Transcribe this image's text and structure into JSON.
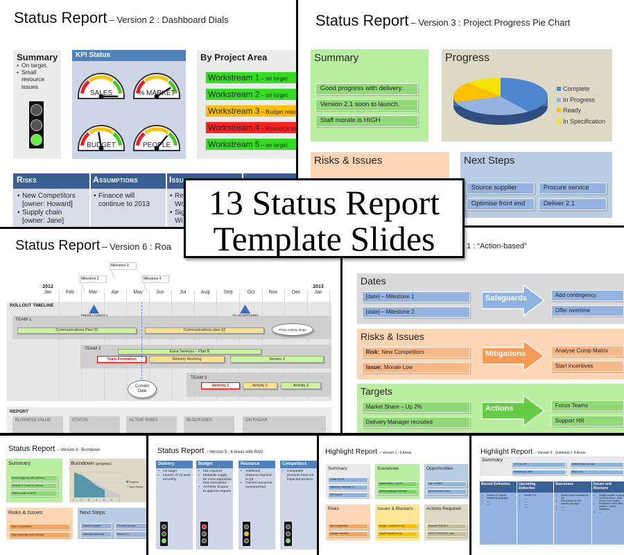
{
  "promo_title": {
    "line1": "13 Status Report",
    "line2": "Template Slides"
  },
  "s1": {
    "title": "Status Report",
    "subtitle": "– Version 2 : Dashboard Dials",
    "summary": {
      "heading": "Summary",
      "bullets": [
        "On target.",
        "Small resource issues"
      ],
      "rag": "green"
    },
    "kpi": {
      "heading": "KPI Status",
      "gauges": [
        {
          "label": "SALES",
          "value": 1.0
        },
        {
          "label": "% MARKET",
          "value": 0.82
        },
        {
          "label": "BUDGET",
          "value": 0.45
        },
        {
          "label": "PEOPLE",
          "value": 0.72
        }
      ]
    },
    "project_area": {
      "heading": "By Project Area",
      "rows": [
        {
          "name": "Workstream 1",
          "status": "– on target",
          "color": "#33dd22"
        },
        {
          "name": "Workstream 2",
          "status": "– on target",
          "color": "#33dd22"
        },
        {
          "name": "Workstream 3",
          "status": "– Budget require",
          "color": "#ffc000"
        },
        {
          "name": "Workstream 4",
          "status": "– Resource issu",
          "color": "#ff2020"
        },
        {
          "name": "Workstream 5",
          "status": "– on target",
          "color": "#33dd22"
        }
      ]
    },
    "table": [
      {
        "heading": "Risks",
        "bullets": [
          "New Competitors [owner: Howard]",
          "Supply chain [owner: Jane]"
        ]
      },
      {
        "heading": "Assumptions",
        "bullets": [
          "Finance will continue to 2013"
        ]
      },
      {
        "heading": "Issues",
        "bullets": [
          "Re\nWo",
          "Sig\nWi"
        ]
      }
    ]
  },
  "s2": {
    "title": "Status Report",
    "subtitle": "– Version 3 : Project Progress Pie Chart",
    "summary": {
      "heading": "Summary",
      "items": [
        "Good progress with delivery.",
        "Version 2.1 soon to launch.",
        "Staff morale is HIGH"
      ]
    },
    "progress": {
      "heading": "Progress"
    },
    "risks": {
      "heading": "Risks & Issues"
    },
    "next_steps": {
      "heading": "Next Steps",
      "items": [
        "Source supplier",
        "Procure service",
        "Optimise front end",
        "Deliver 2.1"
      ]
    },
    "chart_data": {
      "type": "pie",
      "categories": [
        "Complete",
        "In Progress",
        "Ready",
        "In Specification"
      ],
      "values": [
        40,
        30,
        18,
        12
      ],
      "colors": [
        "#4f86d0",
        "#95b3e0",
        "#ffc000",
        "#f5e400"
      ],
      "legend": "right"
    }
  },
  "s3": {
    "title": "Status Report",
    "subtitle": "– Version 6 : Roa",
    "years": [
      "2012",
      "2013"
    ],
    "months": [
      "Jan",
      "Feb",
      "Mar",
      "Apr",
      "May",
      "Jun",
      "Jul",
      "Aug",
      "Sep",
      "Oct",
      "Nov",
      "Dec",
      "Jan"
    ],
    "milestones": [
      "Milestone 2",
      "Milestone 3",
      "Milestone 4"
    ],
    "timeline_label": "ROLLOUT TIMELINE",
    "events": [
      "PRESS LAUNCH 1",
      "TV ADVERTISING"
    ],
    "teams": [
      "TEAM 1",
      "TEAM 2",
      "TEAM 3"
    ],
    "bars": {
      "comms1": "Communications Plan 01",
      "comms2": "Communications plan 02",
      "press_stops": "Press Activity Stops",
      "extra": "Extra Services – Plan B",
      "formation": "Team Formation",
      "norming": "Delivery Norming",
      "version2": "Version 2",
      "act1": "Activity 1",
      "act2": "Activity 2",
      "act3": "Activity 3"
    },
    "current_date": "Current Date",
    "report_label": "REPORT",
    "report_columns": [
      "BUSINESS VALUE",
      "STATUS",
      "ACTIVE RISKS",
      "BLOCKAGES",
      "ON RADAR"
    ]
  },
  "s4": {
    "subtitle": "1 : “Action-based”",
    "rows": [
      {
        "heading": "Dates",
        "left": [
          "[date] – Milestone 1",
          "[date] – Milestone 2"
        ],
        "arrow": "Safeguards",
        "right": [
          "Add contingency",
          "Offer overtime"
        ],
        "bg": "#d9d9d9",
        "item": "#95b3e0",
        "arrow_color": "#8db3e2"
      },
      {
        "heading": "Risks & Issues",
        "left_bold": [
          "Risk:",
          "Issue:"
        ],
        "left": [
          "New Competitors",
          "Morale Low"
        ],
        "arrow": "Mitigations",
        "right": [
          "Analyse Comp Matrix",
          "Start incentives"
        ],
        "bg": "#fcd5b4",
        "item": "#f8b888",
        "arrow_color": "#f79a55"
      },
      {
        "heading": "Targets",
        "left": [
          "Market Share – Up 2%",
          "Delivery Manager recruited"
        ],
        "arrow": "Actions",
        "right": [
          "Focus Teams",
          "Support HR"
        ],
        "bg": "#b8f0a0",
        "item": "#92d97a",
        "arrow_color": "#66cc44"
      }
    ]
  },
  "b1": {
    "title": "Status Report",
    "subtitle": "– Version 4 : Burndown",
    "summary": {
      "heading": "Summary",
      "items": [
        "Good progress with delivery.",
        "Version 2.1 soon to launch.",
        "Staff morale is HIGH"
      ]
    },
    "burndown": {
      "heading": "Burndown",
      "sub": "(progress)"
    },
    "chart_data": {
      "type": "area",
      "x": [
        1,
        2,
        3,
        4,
        5,
        6,
        7
      ],
      "series": [
        {
          "name": "Progress",
          "values": [
            10,
            9,
            7,
            4.5,
            3,
            null,
            null
          ]
        },
        {
          "name": "Ideal Velocity",
          "values": [
            10,
            8.5,
            7,
            5.5,
            4,
            2.5,
            1
          ]
        }
      ],
      "colors": [
        "#4a8fa8",
        "#c8c8c8"
      ]
    },
    "risks": {
      "heading": "Risks & Issues",
      "items": [
        "New Competitors",
        "Raw materials cost increase"
      ]
    },
    "next_steps": {
      "heading": "Next Steps",
      "items": [
        "Source supplier",
        "Procure service",
        "Optimise front end",
        "Deliver 2.1"
      ]
    }
  },
  "b2": {
    "title": "Status Report",
    "subtitle": "– Version 5 : 4 Areas with RAG",
    "columns": [
      {
        "heading": "Delivery",
        "bullets": [
          "On target",
          "Launch of V3 went smoothly"
        ],
        "rag": "green"
      },
      {
        "heading": "Budget",
        "bullets": [
          "£££ required",
          "Materials supply far more expensive than forecasted",
          "ACTION: finance to approve request"
        ],
        "rag": "red"
      },
      {
        "heading": "Resource",
        "bullets": [
          "Additional resource required in Q4",
          "Current resources overstretched"
        ],
        "rag": "amber"
      },
      {
        "heading": "Competitors",
        "bullets": [
          "Competitor products have not impacted product"
        ],
        "rag": "green"
      }
    ]
  },
  "b3": {
    "title": "Highlight Report",
    "subtitle": "– Version 1 : 6 Areas",
    "areas": [
      {
        "heading": "Summary",
        "items": [
          "TEAM GOOD",
          "Marketing Campaign 1.2",
          "RIM support"
        ],
        "bg": "#e8e8e8",
        "item": "#8db3e2"
      },
      {
        "heading": "Successes",
        "items": [
          "Market Share – Up 2%",
          "Delivery Manager recruited"
        ],
        "bg": "#b8f0a0",
        "item": "#7bd66a"
      },
      {
        "heading": "Opportunities",
        "items": [
          "Gap in EMEA",
          "Innovate feature idea"
        ],
        "bg": "#b8cce4",
        "item": "#95b3e0"
      },
      {
        "heading": "Risks",
        "items": [
          "New Competitors",
          "Manager recruited"
        ],
        "bg": "#fcd5b4",
        "item": "#f4a460"
      },
      {
        "heading": "Issues & Blockers",
        "items": [
          "Budget – required for Q4",
          "Signoff required on Q3"
        ],
        "bg": "#ffe699",
        "item": "#ffc000"
      },
      {
        "heading": "Actions Required",
        "items": [
          "Rescope PHASE 2",
          "PEST & PORTERS, now."
        ],
        "bg": "#ddd9c4",
        "item": "#c4bd97"
      }
    ]
  },
  "b4": {
    "title": "Highlight Report",
    "subtitle": "– Version 3 : Summary + 4 Areas",
    "summary": {
      "heading": "Summary",
      "items": [
        "V 3.2 is LIVE",
        "Market Share increase",
        "Marketing on track",
        "Risk is low"
      ]
    },
    "columns": [
      {
        "heading": "Recent Deliveries",
        "bullets": [
          "Version 3.2 launch",
          "Marketing campaign",
          "___",
          "___"
        ]
      },
      {
        "heading": "Upcoming Deliveries",
        "bullets": [
          "Version 3.3",
          "___",
          "___",
          "___",
          "___"
        ]
      },
      {
        "heading": "Successes",
        "bullets": [
          "Market share increased by 2%",
          "Recruitment of new Delivery Manager",
          "___",
          "___"
        ]
      },
      {
        "heading": "Issues and Blockers",
        "bullets": [
          "Widget supplier is going out of business - must source new supplier",
          "Problems in west office location – insect infestation",
          "__"
        ]
      }
    ]
  }
}
